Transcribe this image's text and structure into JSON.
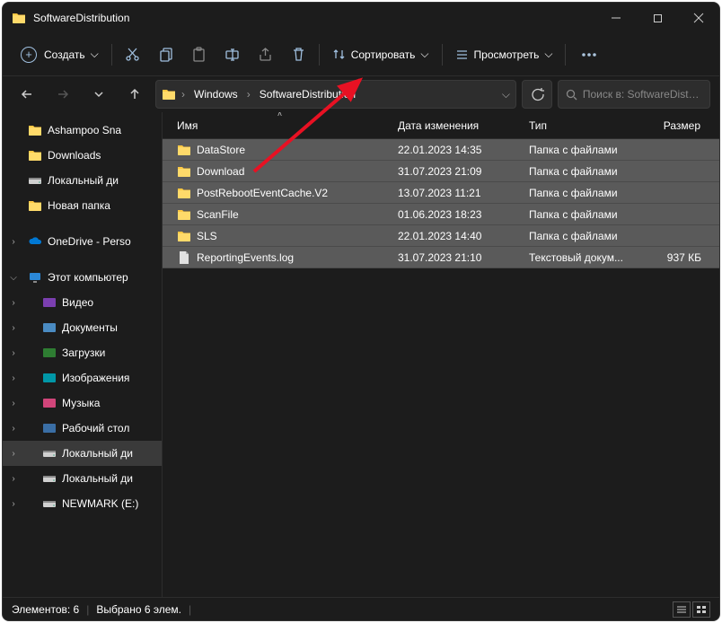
{
  "title": "SoftwareDistribution",
  "toolbar": {
    "new_label": "Создать",
    "sort_label": "Сортировать",
    "view_label": "Просмотреть"
  },
  "breadcrumbs": [
    "Windows",
    "SoftwareDistribution"
  ],
  "search_placeholder": "Поиск в: SoftwareDistri...",
  "columns": {
    "name": "Имя",
    "date": "Дата изменения",
    "type": "Тип",
    "size": "Размер"
  },
  "sidebar": {
    "quick": [
      {
        "label": "Ashampoo Sna",
        "icon": "folder"
      },
      {
        "label": "Downloads",
        "icon": "folder"
      },
      {
        "label": "Локальный ди",
        "icon": "drive"
      },
      {
        "label": "Новая папка",
        "icon": "folder"
      }
    ],
    "onedrive": "OneDrive - Perso",
    "thispc": "Этот компьютер",
    "thispc_children": [
      {
        "label": "Видео",
        "icon": "video"
      },
      {
        "label": "Документы",
        "icon": "docs"
      },
      {
        "label": "Загрузки",
        "icon": "downloads"
      },
      {
        "label": "Изображения",
        "icon": "images"
      },
      {
        "label": "Музыка",
        "icon": "music"
      },
      {
        "label": "Рабочий стол",
        "icon": "desktop"
      },
      {
        "label": "Локальный ди",
        "icon": "drive",
        "sel": true
      },
      {
        "label": "Локальный ди",
        "icon": "drive"
      },
      {
        "label": "NEWMARK (E:)",
        "icon": "drive"
      }
    ]
  },
  "rows": [
    {
      "name": "DataStore",
      "date": "22.01.2023 14:35",
      "type": "Папка с файлами",
      "size": "",
      "icon": "folder"
    },
    {
      "name": "Download",
      "date": "31.07.2023 21:09",
      "type": "Папка с файлами",
      "size": "",
      "icon": "folder"
    },
    {
      "name": "PostRebootEventCache.V2",
      "date": "13.07.2023 11:21",
      "type": "Папка с файлами",
      "size": "",
      "icon": "folder"
    },
    {
      "name": "ScanFile",
      "date": "01.06.2023 18:23",
      "type": "Папка с файлами",
      "size": "",
      "icon": "folder"
    },
    {
      "name": "SLS",
      "date": "22.01.2023 14:40",
      "type": "Папка с файлами",
      "size": "",
      "icon": "folder"
    },
    {
      "name": "ReportingEvents.log",
      "date": "31.07.2023 21:10",
      "type": "Текстовый докум...",
      "size": "937 КБ",
      "icon": "file"
    }
  ],
  "status": {
    "items": "Элементов: 6",
    "selected": "Выбрано 6 элем."
  }
}
